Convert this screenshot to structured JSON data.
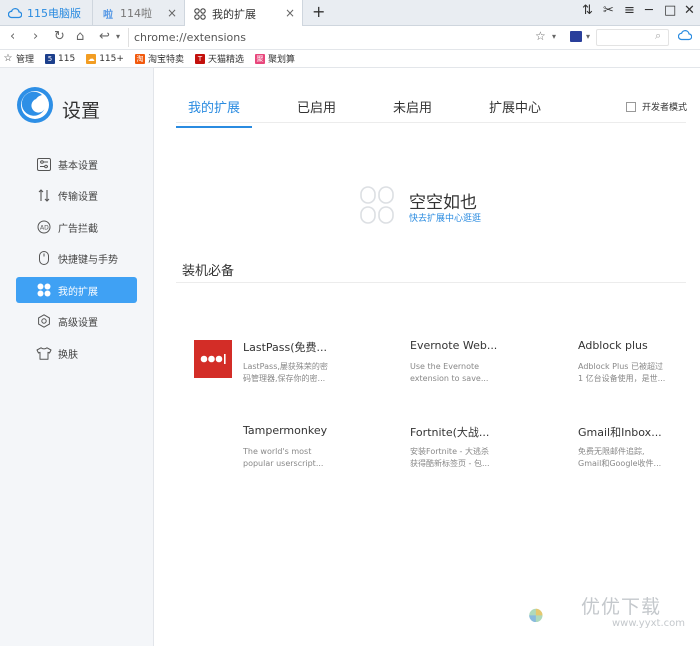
{
  "tabs": [
    {
      "label": "115电脑版"
    },
    {
      "label": "114啦"
    },
    {
      "label": "我的扩展",
      "close": "×"
    }
  ],
  "new_tab": "+",
  "window_controls": {
    "minimize": "─",
    "maximize": "□",
    "close": "✕"
  },
  "address_bar": {
    "url": "chrome://extensions"
  },
  "bookmarks": [
    {
      "label": "管理",
      "icon": "star-icon",
      "color": "#333333"
    },
    {
      "label": "115",
      "icon": "115-icon",
      "color": "#1c3f8c"
    },
    {
      "label": "115+",
      "icon": "cloud-icon",
      "color": "#f29d22"
    },
    {
      "label": "淘宝特卖",
      "icon": "taobao-icon",
      "color": "#f25a0e"
    },
    {
      "label": "天猫精选",
      "icon": "tmall-icon",
      "color": "#c3100c"
    },
    {
      "label": "聚划算",
      "icon": "juhuasuan-icon",
      "color": "#e8467b"
    }
  ],
  "sidebar": {
    "title": "设置",
    "items": [
      {
        "label": "基本设置",
        "icon": "sliders-icon"
      },
      {
        "label": "传输设置",
        "icon": "transfer-icon"
      },
      {
        "label": "广告拦截",
        "icon": "ad-block-icon"
      },
      {
        "label": "快捷键与手势",
        "icon": "mouse-icon"
      },
      {
        "label": "我的扩展",
        "icon": "extensions-icon",
        "active": true
      },
      {
        "label": "高级设置",
        "icon": "gear-icon"
      },
      {
        "label": "换肤",
        "icon": "shirt-icon"
      }
    ]
  },
  "main": {
    "tabs": [
      {
        "label": "我的扩展",
        "active": true
      },
      {
        "label": "已启用"
      },
      {
        "label": "未启用"
      },
      {
        "label": "扩展中心"
      }
    ],
    "dev_mode_label": "开发者模式",
    "empty": {
      "title": "空空如也",
      "link": "快去扩展中心逛逛"
    },
    "section_title": "装机必备",
    "extensions": [
      {
        "name": "LastPass(免费...",
        "desc1": "LastPass,屡获殊荣的密",
        "desc2": "码管理器,保存你的密..."
      },
      {
        "name": "Evernote Web...",
        "desc1": "Use the Evernote",
        "desc2": "extension to save..."
      },
      {
        "name": "Adblock plus",
        "desc1": "Adblock Plus 已被超过",
        "desc2": "1 亿台设备使用，是世..."
      },
      {
        "name": "Tampermonkey",
        "desc1": "The world's most",
        "desc2": "popular userscript..."
      },
      {
        "name": "Fortnite(大战...",
        "desc1": "安装Fortnite - 大逃杀",
        "desc2": "获得酷新标签页 - 包..."
      },
      {
        "name": "Gmail和Inbox...",
        "desc1": "免费无限邮件追踪,",
        "desc2": "Gmail和Google收件..."
      }
    ]
  },
  "watermark": {
    "text": "优优下载",
    "url": "www.yyxt.com"
  }
}
